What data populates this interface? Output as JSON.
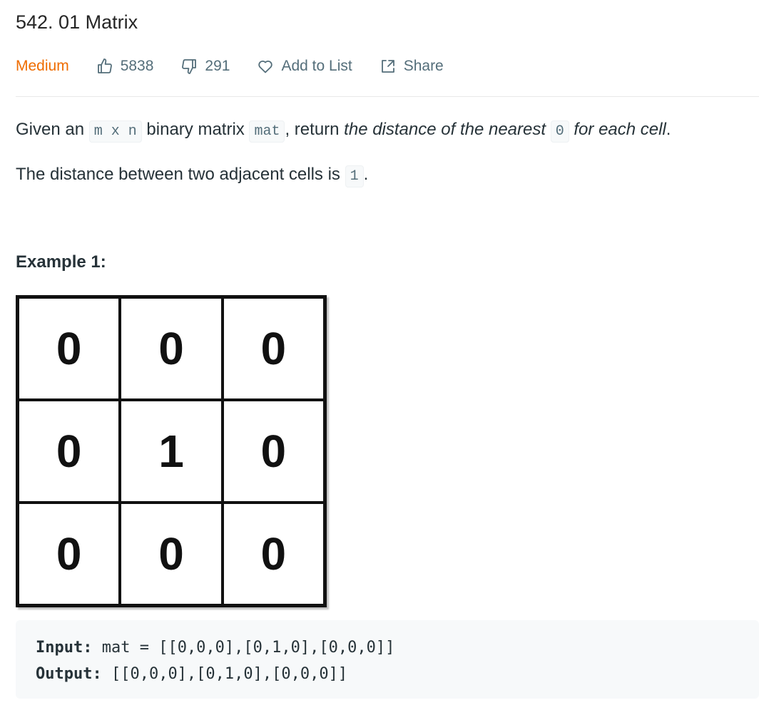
{
  "problem": {
    "title": "542. 01 Matrix",
    "difficulty": "Medium",
    "likes": "5838",
    "dislikes": "291",
    "add_to_list": "Add to List",
    "share": "Share"
  },
  "description": {
    "p1_prefix": "Given an ",
    "p1_code1": "m x n",
    "p1_mid1": " binary matrix ",
    "p1_code2": "mat",
    "p1_mid2": ", return ",
    "p1_em1": "the distance of the nearest ",
    "p1_code3": "0",
    "p1_em2": " for each cell",
    "p1_suffix": ".",
    "p2_prefix": "The distance between two adjacent cells is ",
    "p2_code": "1",
    "p2_suffix": "."
  },
  "example": {
    "title": "Example 1:",
    "matrix": [
      [
        "0",
        "0",
        "0"
      ],
      [
        "0",
        "1",
        "0"
      ],
      [
        "0",
        "0",
        "0"
      ]
    ],
    "input_label": "Input:",
    "input_value": "mat = [[0,0,0],[0,1,0],[0,0,0]]",
    "output_label": "Output:",
    "output_value": "[[0,0,0],[0,1,0],[0,0,0]]"
  },
  "colors": {
    "difficulty": "#ef6c00",
    "meta_text": "#546e7a",
    "code_bg": "#f7f9fa"
  },
  "icons": {
    "likes": "thumbs-up-icon",
    "dislikes": "thumbs-down-icon",
    "add_to_list": "heart-icon",
    "share": "share-icon"
  }
}
